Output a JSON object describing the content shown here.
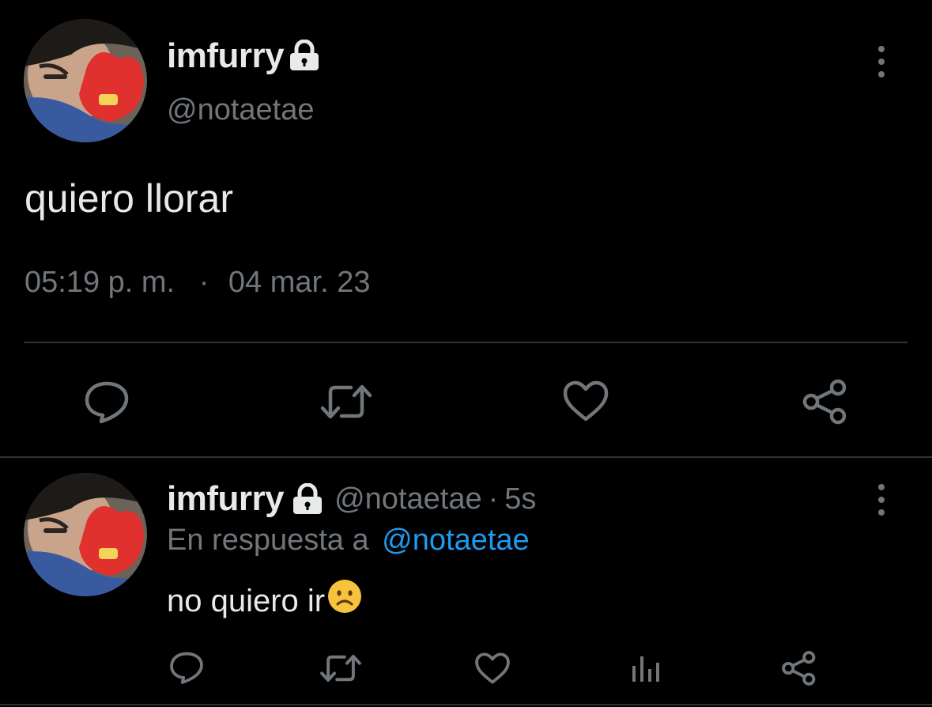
{
  "main_tweet": {
    "display_name": "imfurry",
    "handle": "@notaetae",
    "text": "quiero llorar",
    "time": "05:19 p. m.",
    "separator": "·",
    "date": "04 mar. 23"
  },
  "reply": {
    "display_name": "imfurry",
    "handle": "@notaetae",
    "dot": "·",
    "age": "5s",
    "reply_prefix": "En respuesta a",
    "reply_to": "@notaetae",
    "text": "no quiero ir",
    "emoji": "☹"
  },
  "colors": {
    "background": "#000000",
    "text": "#e7e9ea",
    "muted": "#71767b",
    "link": "#1d9bf0",
    "divider": "#2f3336"
  },
  "icons": [
    "lock-icon",
    "more-options-icon",
    "reply-icon",
    "retweet-icon",
    "like-icon",
    "share-icon",
    "analytics-icon"
  ]
}
